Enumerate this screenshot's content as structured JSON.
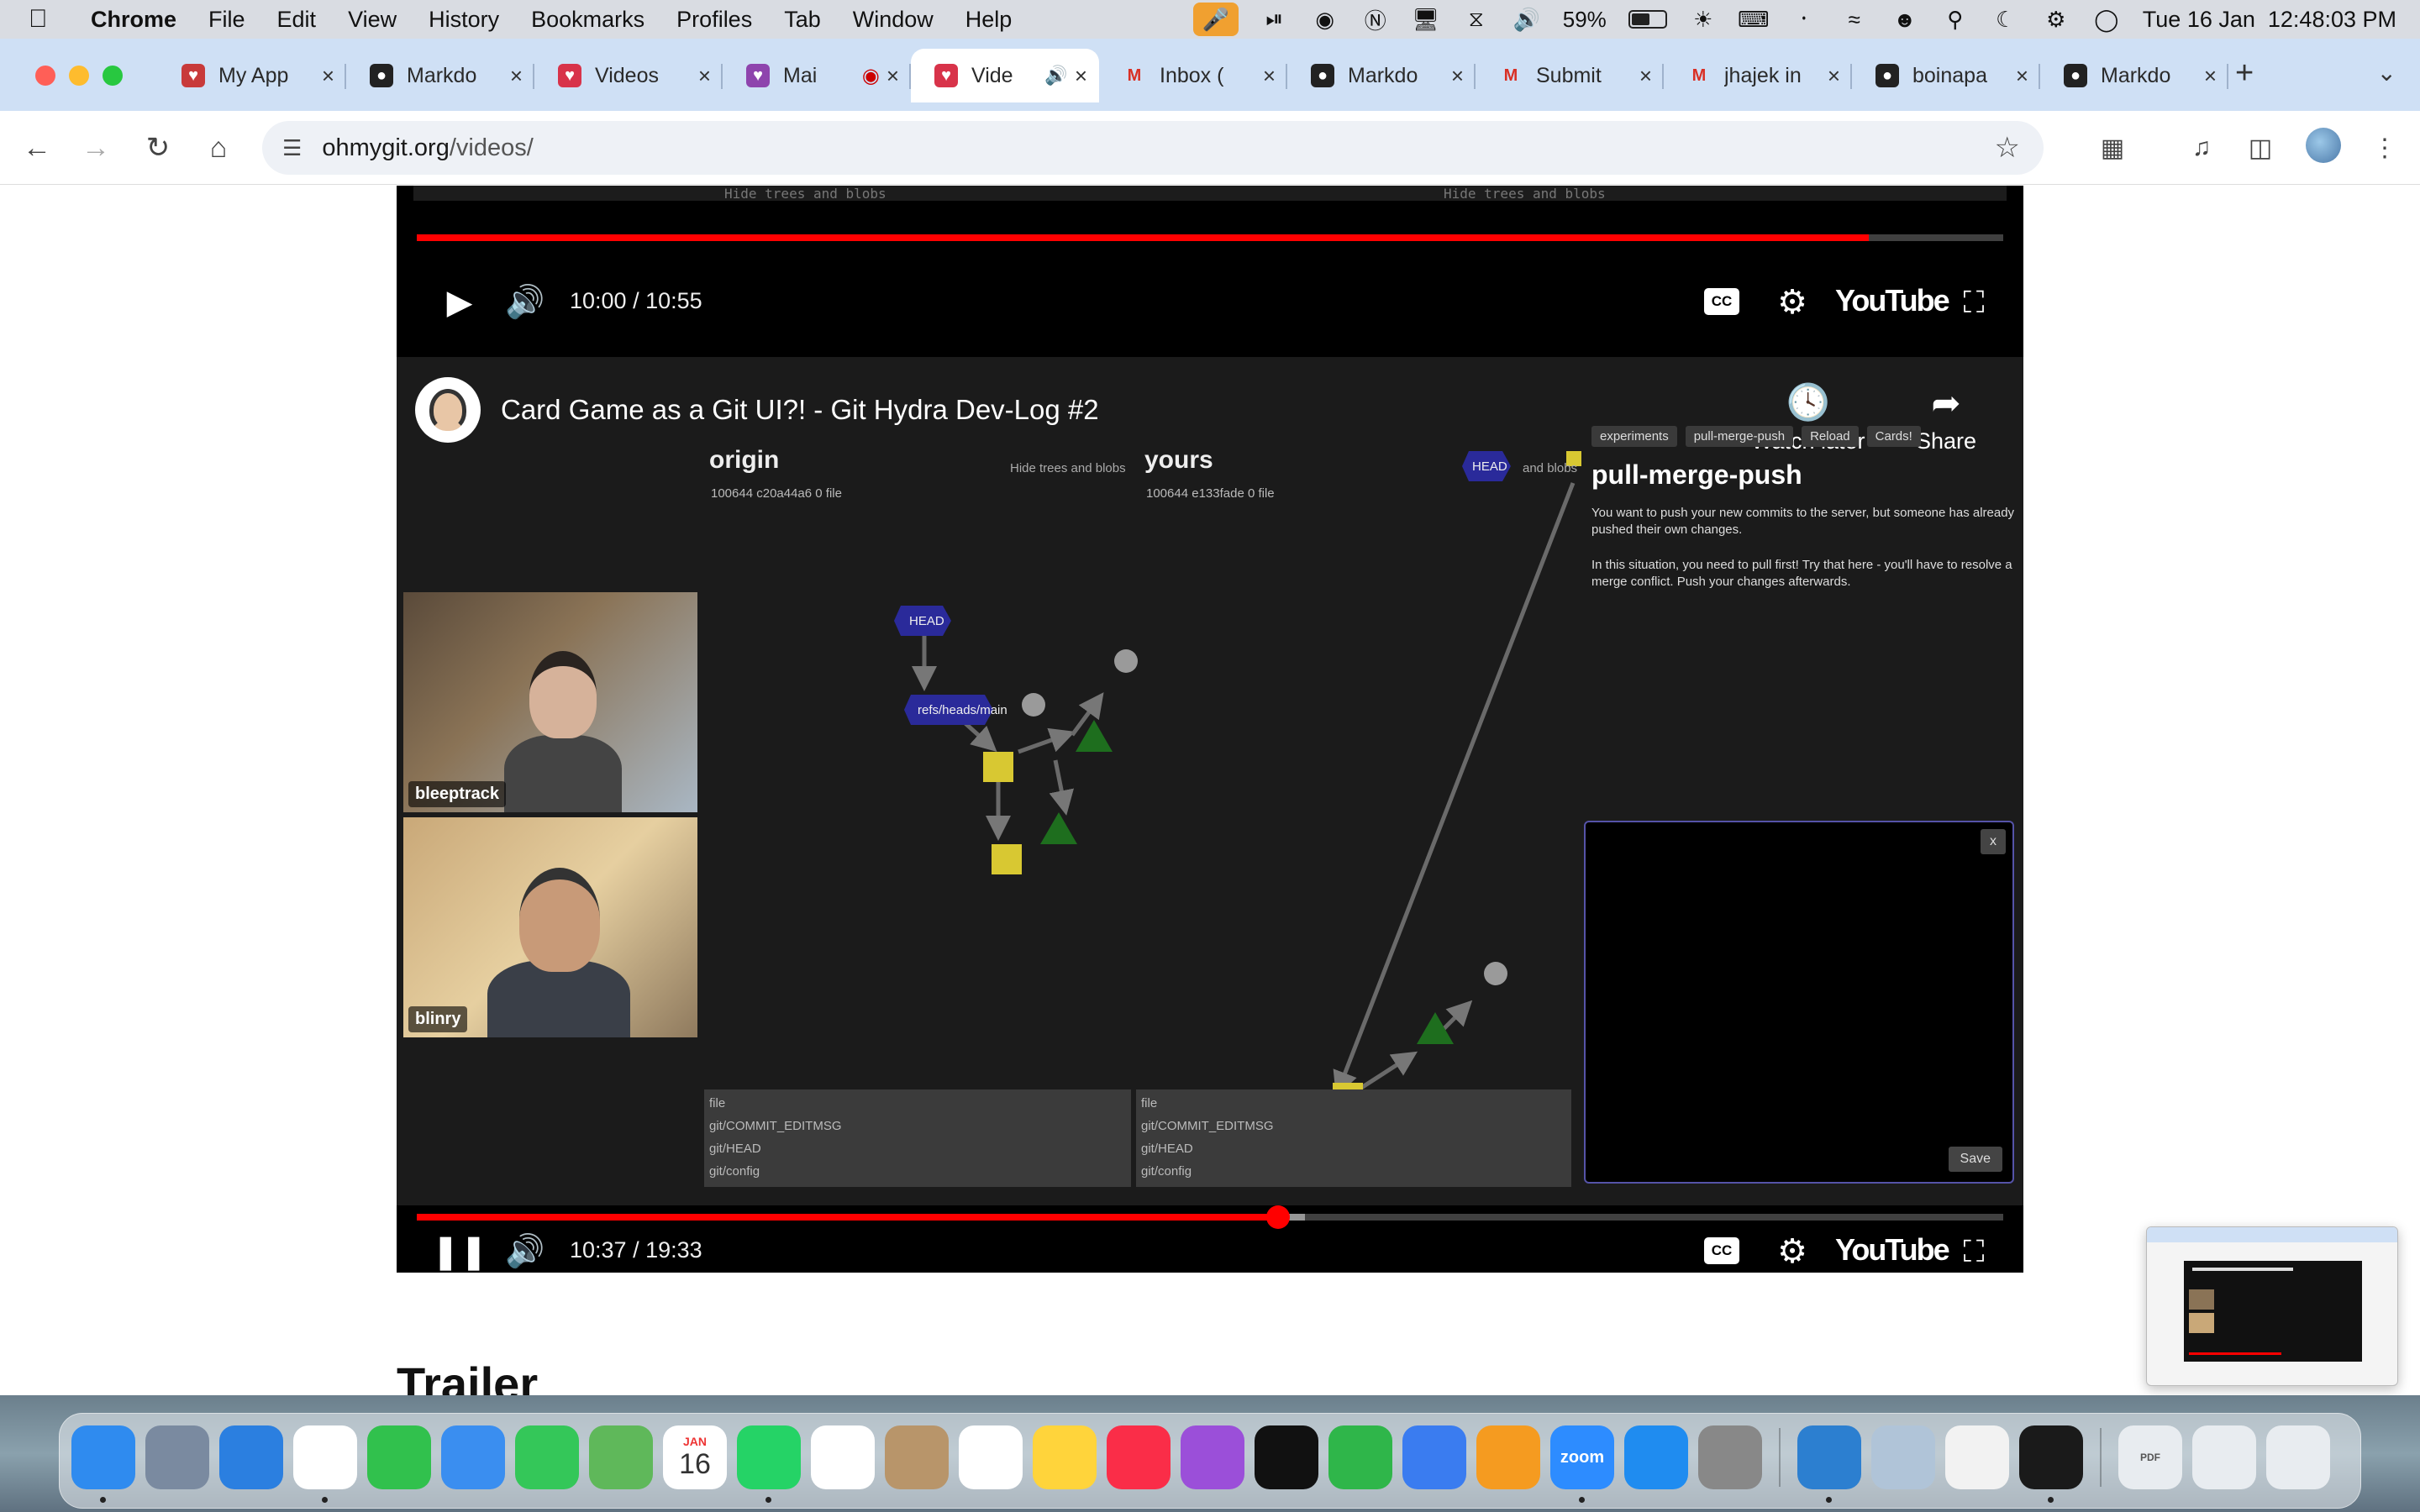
{
  "menubar": {
    "app_name": "Chrome",
    "menus": [
      "File",
      "Edit",
      "View",
      "History",
      "Bookmarks",
      "Profiles",
      "Tab",
      "Window",
      "Help"
    ],
    "battery_percent": "59%",
    "battery_level": 0.59,
    "datetime": "Tue 16 Jan  12:48:03 PM"
  },
  "tabs": [
    {
      "title": "My App",
      "favicon": "heart-icon",
      "color": "#c83a3a"
    },
    {
      "title": "Markdo",
      "favicon": "github-icon",
      "color": "#222222"
    },
    {
      "title": "Videos",
      "favicon": "ohmygit-icon",
      "color": "#d8334a"
    },
    {
      "title": "Mai",
      "favicon": "video-icon",
      "color": "#8e44ad"
    },
    {
      "title": "Vide",
      "favicon": "ohmygit-icon",
      "color": "#d8334a",
      "active": true
    },
    {
      "title": "Inbox (",
      "favicon": "gmail-icon",
      "color": "#d93025"
    },
    {
      "title": "Markdo",
      "favicon": "github-icon",
      "color": "#222222"
    },
    {
      "title": "Submit",
      "favicon": "gmail-icon",
      "color": "#d93025"
    },
    {
      "title": "jhajek in",
      "favicon": "gmail-icon",
      "color": "#d93025"
    },
    {
      "title": "boinapa",
      "favicon": "github-icon",
      "color": "#222222"
    },
    {
      "title": "Markdo",
      "favicon": "github-icon",
      "color": "#222222"
    }
  ],
  "toolbar": {
    "url_host": "ohmygit.org",
    "url_path": "/videos/"
  },
  "player1": {
    "time": "10:00 / 10:55",
    "progress": 0.915,
    "captions": [
      "Hide trees and blobs",
      "Hide trees and blobs"
    ],
    "brand": "YouTube",
    "cc": "CC"
  },
  "player2": {
    "title": "Card Game as a Git UI?! - Git Hydra Dev-Log #2",
    "watch_later": "Watch later",
    "share": "Share",
    "time": "10:37 / 19:33",
    "progress": 0.543,
    "buffered": 0.56,
    "brand": "YouTube",
    "cc": "CC",
    "origin": {
      "heading": "origin",
      "file": "100644 c20a44a6 0 file",
      "hide_toggle": "Hide trees and blobs"
    },
    "yours": {
      "heading": "yours",
      "file": "100644 e133fade 0 file",
      "hide_toggle": "and blobs",
      "head": "HEAD"
    },
    "graph_labels": {
      "head": "HEAD",
      "ref": "refs/heads/main"
    },
    "level_tabs": [
      "experiments",
      "pull-merge-push",
      "Reload",
      "Cards!"
    ],
    "level_title": "pull-merge-push",
    "level_desc_1": "You want to push your new commits to the server, but someone has already pushed their own changes.",
    "level_desc_2": "In this situation, you need to pull first! Try that here - you'll have to resolve a merge conflict. Push your changes afterwards.",
    "terminal": {
      "close": "x",
      "save": "Save"
    },
    "files_left": [
      "file",
      "git/COMMIT_EDITMSG",
      "git/HEAD",
      "git/config"
    ],
    "files_right": [
      "file",
      "git/COMMIT_EDITMSG",
      "git/HEAD",
      "git/config"
    ],
    "cam1": "bleeptrack",
    "cam2": "blinry"
  },
  "page": {
    "section_heading": "Trailer"
  },
  "dock": {
    "calendar_month": "JAN",
    "calendar_day": "16",
    "zoom": "zoom",
    "apps": [
      {
        "name": "finder-icon",
        "color": "#2f8bef",
        "running": true
      },
      {
        "name": "launchpad-icon",
        "color": "#7a8aa0"
      },
      {
        "name": "safari-icon",
        "color": "#2b7fe0"
      },
      {
        "name": "chrome-icon",
        "color": "#ffffff",
        "running": true
      },
      {
        "name": "facetime-icon",
        "color": "#31c14d"
      },
      {
        "name": "mail-icon",
        "color": "#3a8ef0"
      },
      {
        "name": "messages-icon",
        "color": "#34c759"
      },
      {
        "name": "maps-icon",
        "color": "#5fb85a"
      },
      {
        "name": "calendar-icon",
        "color": "#ffffff"
      },
      {
        "name": "whatsapp-icon",
        "color": "#25d366",
        "running": true
      },
      {
        "name": "reminders-icon",
        "color": "#ffffff"
      },
      {
        "name": "contacts-icon",
        "color": "#b8956a"
      },
      {
        "name": "photos-icon",
        "color": "#ffffff"
      },
      {
        "name": "notes-icon",
        "color": "#ffd43b"
      },
      {
        "name": "music-icon",
        "color": "#fa2d48"
      },
      {
        "name": "podcasts-icon",
        "color": "#9b4fd9"
      },
      {
        "name": "appletv-icon",
        "color": "#111111"
      },
      {
        "name": "numbers-icon",
        "color": "#2fb64a"
      },
      {
        "name": "keynote-icon",
        "color": "#3a7cf0"
      },
      {
        "name": "pages-icon",
        "color": "#f59b20"
      },
      {
        "name": "zoom-icon",
        "color": "#2d8cff",
        "running": true
      },
      {
        "name": "appstore-icon",
        "color": "#1f8cf0"
      },
      {
        "name": "settings-icon",
        "color": "#888888"
      }
    ],
    "apps2": [
      {
        "name": "vscode-icon",
        "color": "#2c7fd0",
        "running": true
      },
      {
        "name": "preview-icon",
        "color": "#b0c4d8"
      },
      {
        "name": "textedit-icon",
        "color": "#f2f2f2"
      },
      {
        "name": "terminal-icon",
        "color": "#1a1a1a",
        "running": true
      }
    ],
    "files": [
      {
        "name": "pdf-document-icon",
        "label": "PDF"
      },
      {
        "name": "documents-stack-icon"
      },
      {
        "name": "trash-icon"
      }
    ]
  }
}
